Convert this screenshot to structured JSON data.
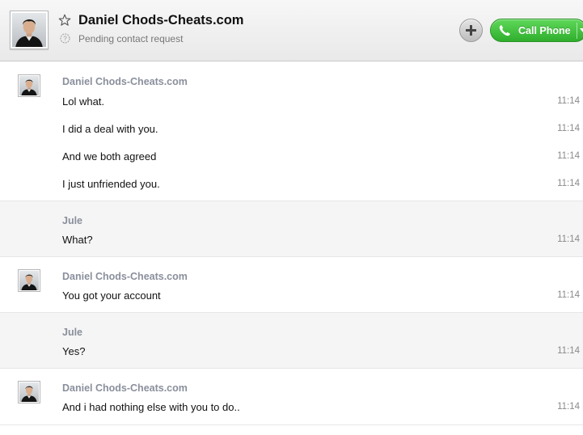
{
  "header": {
    "contact_name": "Daniel Chods-Cheats.com",
    "status": "Pending contact request",
    "call_label": "Call Phone",
    "icons": {
      "star": "star-icon",
      "pending": "pending-request-icon",
      "add": "plus-icon",
      "phone": "phone-icon",
      "dropdown": "chevron-down-icon"
    },
    "colors": {
      "call_green": "#3cbf38",
      "sender_gray": "#8a8f9c"
    }
  },
  "messages": [
    {
      "sender": "Daniel Chods-Cheats.com",
      "lines": [
        {
          "text": "Lol what.",
          "time": "11:14"
        },
        {
          "text": "I did a deal with you.",
          "time": "11:14"
        },
        {
          "text": "And we both agreed",
          "time": "11:14"
        },
        {
          "text": "I just unfriended you.",
          "time": "11:14"
        }
      ]
    },
    {
      "sender": "Jule",
      "lines": [
        {
          "text": "What?",
          "time": "11:14"
        }
      ]
    },
    {
      "sender": "Daniel Chods-Cheats.com",
      "lines": [
        {
          "text": "You got your account",
          "time": "11:14"
        }
      ]
    },
    {
      "sender": "Jule",
      "lines": [
        {
          "text": "Yes?",
          "time": "11:14"
        }
      ]
    },
    {
      "sender": "Daniel Chods-Cheats.com",
      "lines": [
        {
          "text": "And i had nothing else with you to do..",
          "time": "11:14"
        }
      ]
    }
  ]
}
